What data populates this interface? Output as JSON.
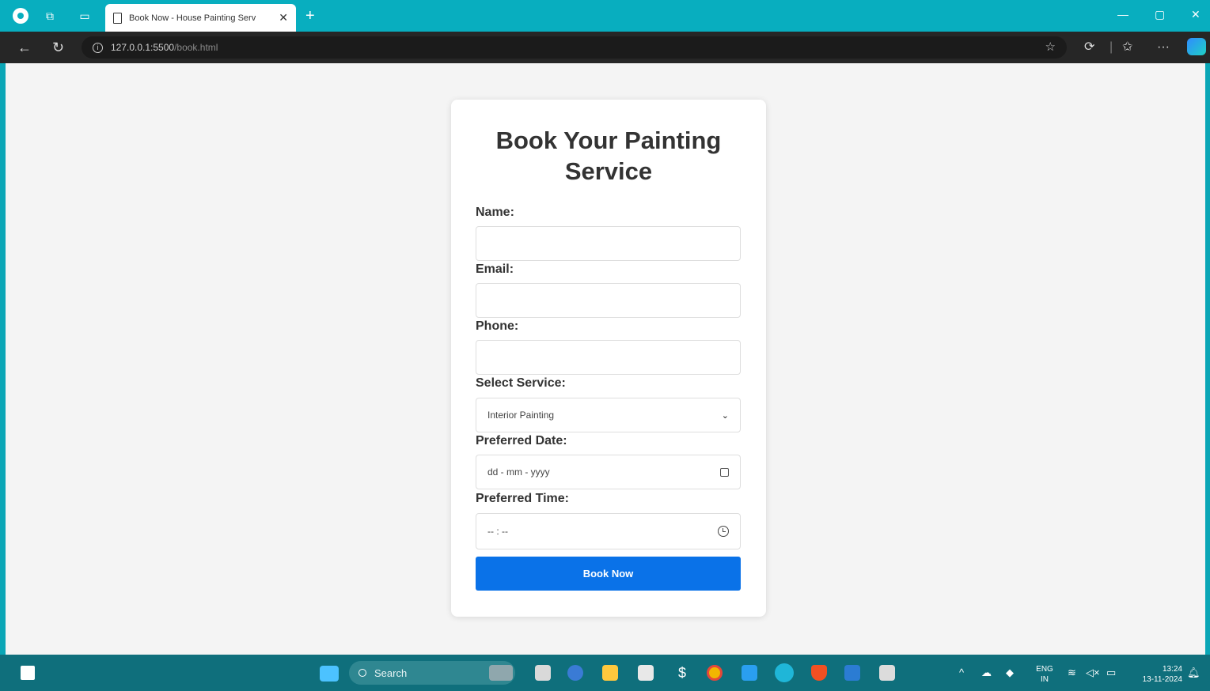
{
  "browser": {
    "tab_title": "Book Now - House Painting Serv",
    "tab_close": "✕",
    "new_tab": "+",
    "url_host": "127.0.0.1:5500",
    "url_path": "/book.html",
    "window_minimize": "—",
    "window_restore": "▢",
    "window_close": "✕"
  },
  "page": {
    "heading": "Book Your Painting Service",
    "fields": {
      "name_label": "Name:",
      "email_label": "Email:",
      "phone_label": "Phone:",
      "service_label": "Select Service:",
      "service_selected": "Interior Painting",
      "date_label": "Preferred Date:",
      "date_placeholder": "dd - mm - yyyy",
      "time_label": "Preferred Time:",
      "time_placeholder": "-- : --"
    },
    "submit_label": "Book Now"
  },
  "taskbar": {
    "search_label": "Search",
    "language_top": "ENG",
    "language_bottom": "IN",
    "time": "13:24",
    "date": "13-11-2024",
    "icons": [
      "start-icon",
      "widgets-icon",
      "file-explorer-icon",
      "edge-icon",
      "store-icon",
      "chrome-icon",
      "vscode-icon",
      "brave-icon",
      "word-icon"
    ]
  },
  "colors": {
    "titlebar": "#08aebf",
    "addressbar": "#262626",
    "page_bg": "#f4f4f4",
    "button": "#0a72e8",
    "taskbar": "#0f6f7c"
  }
}
